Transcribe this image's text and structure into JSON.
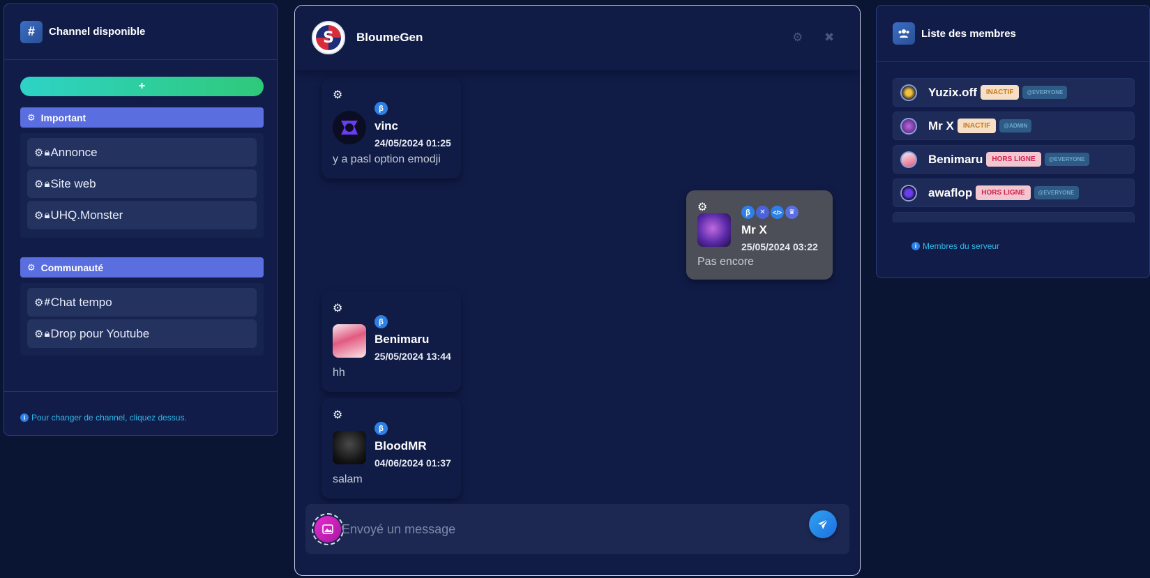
{
  "left": {
    "title": "Channel disponible",
    "add_label": "+",
    "categories": [
      {
        "name": "Important",
        "channels": [
          {
            "name": "Annonce",
            "icon": "lock-icon"
          },
          {
            "name": "Site web",
            "icon": "lock-icon"
          },
          {
            "name": "UHQ.Monster",
            "icon": "lock-icon"
          }
        ]
      },
      {
        "name": "Communauté",
        "channels": [
          {
            "name": "Chat tempo",
            "icon": "hash-icon"
          },
          {
            "name": "Drop pour Youtube",
            "icon": "lock-icon"
          }
        ]
      }
    ],
    "footer_note": "Pour changer de channel, cliquez dessus."
  },
  "chat": {
    "server_name": "BloumeGen",
    "messages": [
      {
        "user": "vinc",
        "time": "24/05/2024 01:25",
        "text": "y a pasl option emodji",
        "badges": [
          "beta"
        ]
      },
      {
        "user": "Mr X",
        "time": "25/05/2024 03:22",
        "text": "Pas encore",
        "badges": [
          "beta",
          "tools",
          "code",
          "crown"
        ]
      },
      {
        "user": "Benimaru",
        "time": "25/05/2024 13:44",
        "text": "hh",
        "badges": [
          "beta"
        ]
      },
      {
        "user": "BloodMR",
        "time": "04/06/2024 01:37",
        "text": "salam",
        "badges": [
          "beta"
        ]
      }
    ],
    "input_placeholder": "Envoyé un message"
  },
  "right": {
    "title": "Liste des membres",
    "members": [
      {
        "name": "Yuzix.off",
        "status": "INACTIF",
        "role": "@EVERYONE"
      },
      {
        "name": "Mr X",
        "status": "INACTIF",
        "role": "@ADMIN"
      },
      {
        "name": "Benimaru",
        "status": "HORS LIGNE",
        "role": "@EVERYONE"
      },
      {
        "name": "awaflop",
        "status": "HORS LIGNE",
        "role": "@EVERYONE"
      }
    ],
    "footer_note": "Membres du serveur"
  },
  "colors": {
    "background": "#0a1433",
    "panel": "#111d48",
    "accent": "#5b6ee0",
    "add_gradient_start": "#2ed3c6",
    "add_gradient_end": "#2fc97a",
    "info": "#2fb8e6"
  }
}
